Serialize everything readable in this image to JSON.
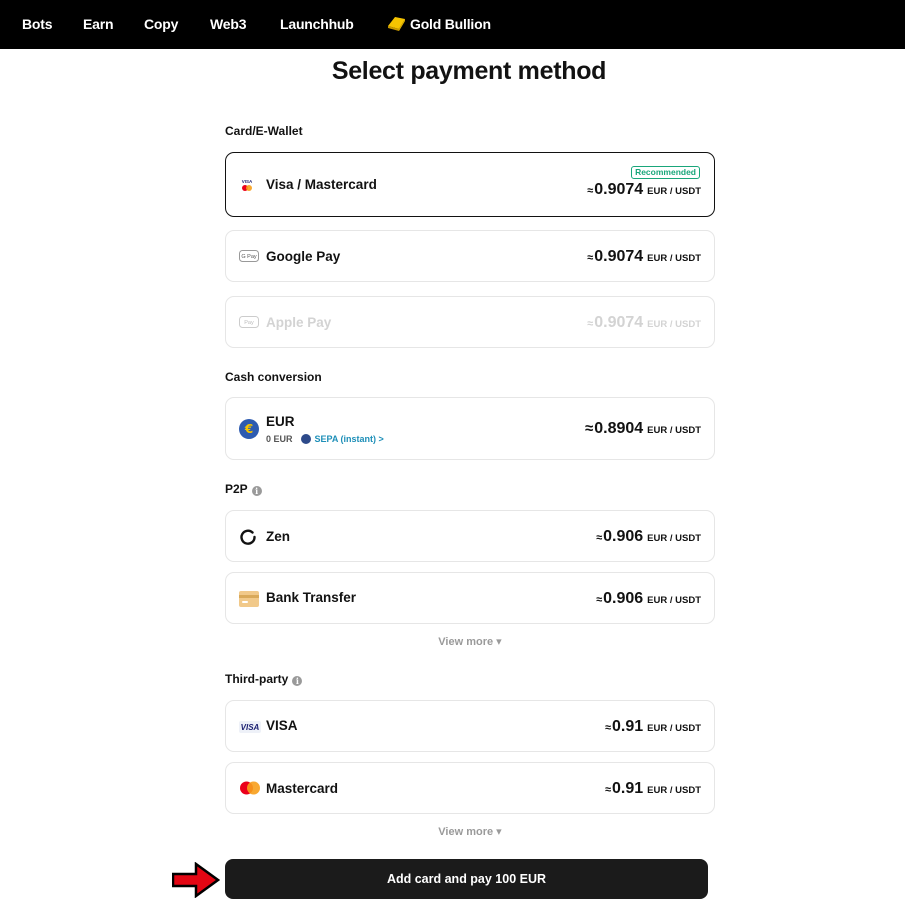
{
  "nav": {
    "items": [
      "Bots",
      "Earn",
      "Copy",
      "Web3",
      "Launchhub",
      "Gold Bullion"
    ]
  },
  "title": "Select payment method",
  "sections": {
    "card_wallet": "Card/E-Wallet",
    "cash_conversion": "Cash conversion",
    "p2p": "P2P",
    "third_party": "Third-party"
  },
  "methods": {
    "visa_mastercard": {
      "name": "Visa / Mastercard",
      "approx": "≈",
      "rate": "0.9074",
      "unit": "EUR / USDT",
      "badge": "Recommended",
      "icon": "visa-mastercard-icon"
    },
    "google_pay": {
      "name": "Google Pay",
      "approx": "≈",
      "rate": "0.9074",
      "unit": "EUR / USDT",
      "icon": "google-pay-icon"
    },
    "apple_pay": {
      "name": "Apple Pay",
      "approx": "≈",
      "rate": "0.9074",
      "unit": "EUR / USDT",
      "icon": "apple-pay-icon"
    },
    "eur": {
      "name": "EUR",
      "approx": "≈",
      "rate": "0.8904",
      "unit": "EUR / USDT",
      "balance": "0 EUR",
      "link": "SEPA (instant) >",
      "icon": "euro-icon"
    },
    "zen": {
      "name": "Zen",
      "approx": "≈",
      "rate": "0.906",
      "unit": "EUR / USDT",
      "icon": "zen-icon"
    },
    "bank_transfer": {
      "name": "Bank Transfer",
      "approx": "≈",
      "rate": "0.906",
      "unit": "EUR / USDT",
      "icon": "bank-card-icon"
    },
    "visa": {
      "name": "VISA",
      "approx": "≈",
      "rate": "0.91",
      "unit": "EUR / USDT",
      "icon": "visa-icon"
    },
    "mastercard": {
      "name": "Mastercard",
      "approx": "≈",
      "rate": "0.91",
      "unit": "EUR / USDT",
      "icon": "mastercard-icon"
    }
  },
  "view_more": "View more ▾",
  "pay_button": "Add card and pay 100 EUR",
  "colors": {
    "nav_bg": "#000000",
    "recommended": "#19a67a",
    "link": "#1e8fb8",
    "pay_button_bg": "#1b1b1b",
    "arrow": "#e30613"
  }
}
